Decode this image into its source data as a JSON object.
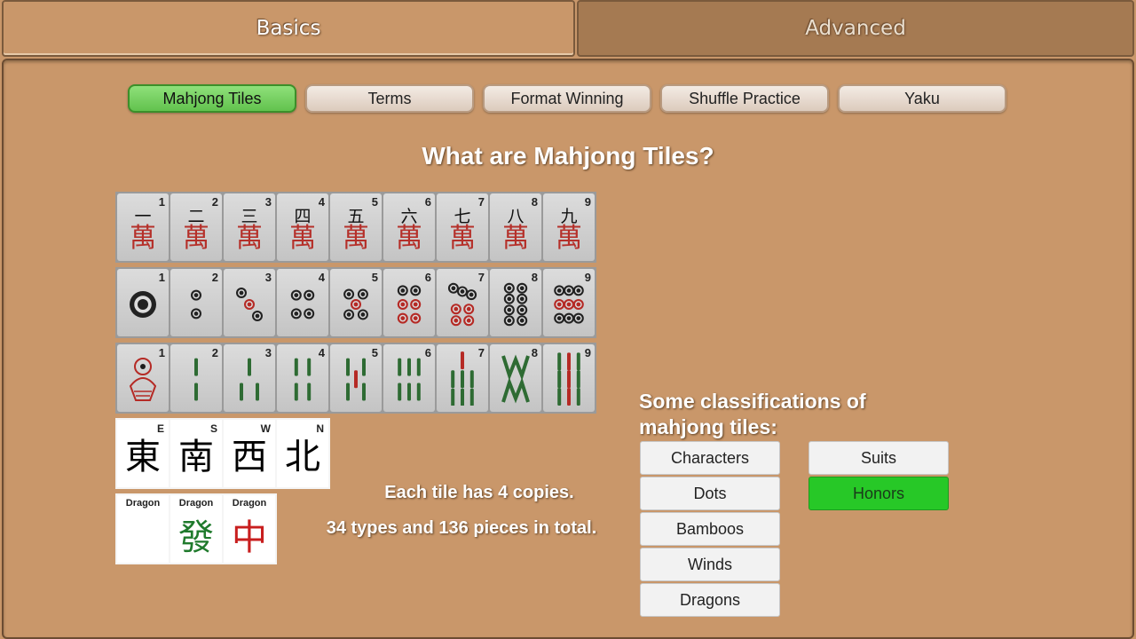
{
  "main_tabs": [
    {
      "label": "Basics",
      "active": true
    },
    {
      "label": "Advanced",
      "active": false
    }
  ],
  "sub_tabs": [
    {
      "label": "Mahjong Tiles",
      "active": true
    },
    {
      "label": "Terms",
      "active": false
    },
    {
      "label": "Format Winning",
      "active": false
    },
    {
      "label": "Shuffle Practice",
      "active": false
    },
    {
      "label": "Yaku",
      "active": false
    }
  ],
  "heading": "What are Mahjong Tiles?",
  "tile_numbers": [
    "1",
    "2",
    "3",
    "4",
    "5",
    "6",
    "7",
    "8",
    "9"
  ],
  "characters": {
    "numerals": [
      "一",
      "二",
      "三",
      "四",
      "五",
      "六",
      "七",
      "八",
      "九"
    ],
    "suffix": "萬"
  },
  "winds": [
    {
      "corner": "E",
      "glyph": "東"
    },
    {
      "corner": "S",
      "glyph": "南"
    },
    {
      "corner": "W",
      "glyph": "西"
    },
    {
      "corner": "N",
      "glyph": "北"
    }
  ],
  "dragons": [
    {
      "label": "Dragon",
      "glyph": "",
      "color": "#ffffff"
    },
    {
      "label": "Dragon",
      "glyph": "發",
      "color": "#1f7a2c"
    },
    {
      "label": "Dragon",
      "glyph": "中",
      "color": "#c81e1e"
    }
  ],
  "info": {
    "copies": "Each tile has 4 copies.",
    "total": "34 types and 136 pieces in total."
  },
  "classification": {
    "title_line1": "Some classifications of",
    "title_line2": "mahjong tiles:",
    "left_buttons": [
      "Characters",
      "Dots",
      "Bamboos",
      "Winds",
      "Dragons"
    ],
    "right_buttons": [
      {
        "label": "Suits",
        "selected": false
      },
      {
        "label": "Honors",
        "selected": true
      }
    ]
  },
  "colors": {
    "accent_green": "#27c827",
    "background": "#c9976a",
    "character_red": "#b5302a",
    "bamboo_green": "#2e6b33"
  }
}
